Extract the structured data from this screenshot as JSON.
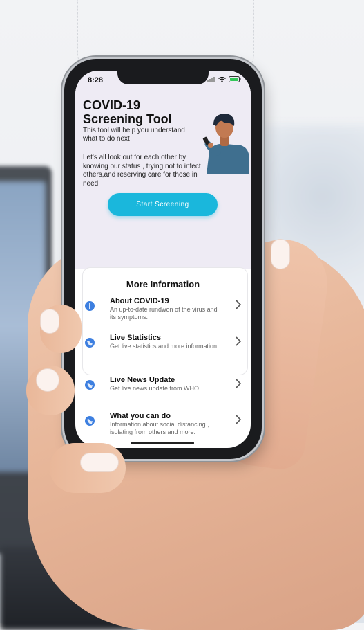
{
  "status_bar": {
    "time": "8:28"
  },
  "hero": {
    "title": "COVID-19\nScreening Tool",
    "subtitle": "This tool will help you understand what to do next",
    "description": "Let's all look out for each other by knowing our status , trying not to infect others,and reserving care for those in need",
    "start_button": "Start Screening"
  },
  "more_info": {
    "title": "More Information",
    "items": [
      {
        "label": "About COVID-19",
        "sub": "An up-to-date rundwon of the virus and its symptoms.",
        "icon": "info-icon"
      },
      {
        "label": "Live Statistics",
        "sub": "Get live statistics and more information.",
        "icon": "globe-icon"
      },
      {
        "label": "Live News Update",
        "sub": "Get live news update from WHO",
        "icon": "globe-icon"
      },
      {
        "label": "What you can do",
        "sub": "Information about social distancing , isolating from others and more.",
        "icon": "globe-icon"
      }
    ]
  },
  "colors": {
    "accent": "#1ab7dc",
    "hero_bg": "#eeebf4",
    "icon_blue": "#3d7fe0"
  }
}
